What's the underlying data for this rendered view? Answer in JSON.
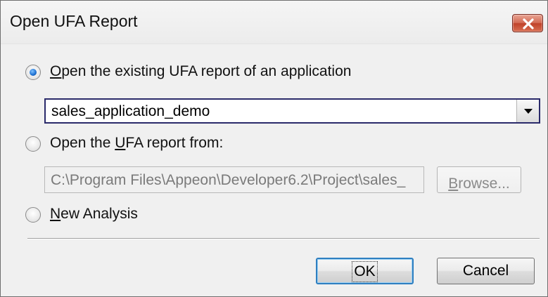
{
  "window": {
    "title": "Open UFA Report",
    "close_icon": "close-icon"
  },
  "options": {
    "existing": {
      "label_prefix": "",
      "label_underline": "O",
      "label_rest": "pen the existing UFA report of an application",
      "checked": true
    },
    "from_file": {
      "label_prefix": "Open the ",
      "label_underline": "U",
      "label_rest": "FA report from:",
      "checked": false
    },
    "new_analysis": {
      "label_prefix": "",
      "label_underline": "N",
      "label_rest": "ew Analysis",
      "checked": false
    }
  },
  "application_combo": {
    "value": "sales_application_demo",
    "arrow_icon": "chevron-down-icon"
  },
  "path_field": {
    "value": "C:\\Program Files\\Appeon\\Developer6.2\\Project\\sales_",
    "disabled": true
  },
  "browse_button": {
    "label_underline": "B",
    "label_rest": "rowse...",
    "disabled": true
  },
  "footer": {
    "ok_label": "OK",
    "cancel_label": "Cancel"
  }
}
